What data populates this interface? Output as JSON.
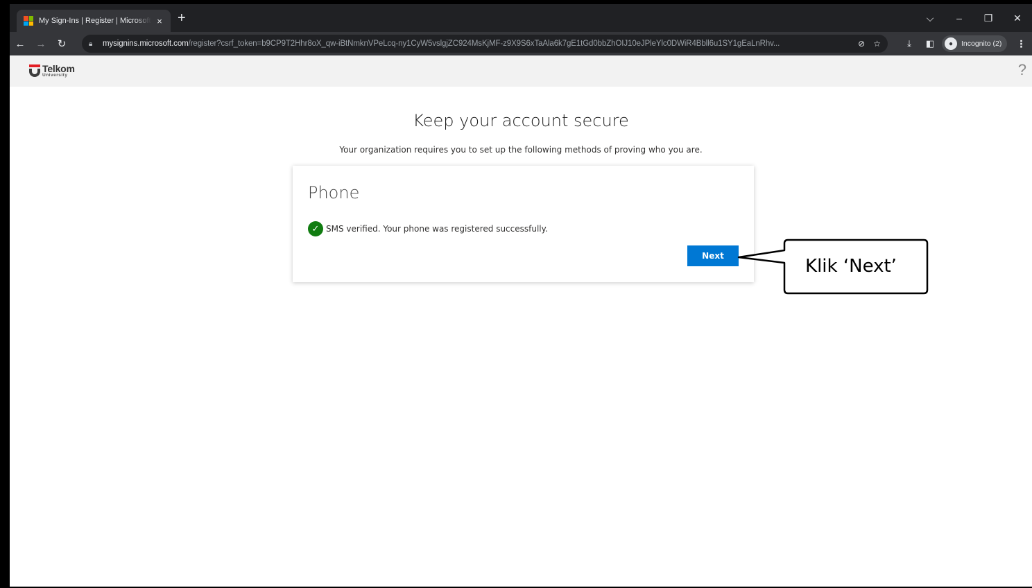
{
  "browser": {
    "tab_title": "My Sign-Ins | Register | Microsoft",
    "tab_close": "×",
    "new_tab": "+",
    "url_host": "mysignins.microsoft.com",
    "url_path": "/register?csrf_token=b9CP9T2Hhr8oX_qw-iBtNmknVPeLcq-ny1CyW5vslgjZC924MsKjMF-z9X9S6xTaAla6k7gE1tGd0bbZhOIJ10eJPleYlc0DWiR4Bbll6u1SY1gEaLnRhv...",
    "incognito_label": "Incognito (2)"
  },
  "header": {
    "logo_main": "Telkom",
    "logo_sub": "University",
    "help": "?"
  },
  "main": {
    "title": "Keep your account secure",
    "subtitle": "Your organization requires you to set up the following methods of proving who you are."
  },
  "card": {
    "title": "Phone",
    "status": "SMS verified. Your phone was registered successfully.",
    "next_label": "Next"
  },
  "callout": {
    "text": "Klik ‘Next’"
  },
  "colors": {
    "primary_button": "#0078d4",
    "success": "#107c10",
    "browser_dark": "#202124"
  }
}
